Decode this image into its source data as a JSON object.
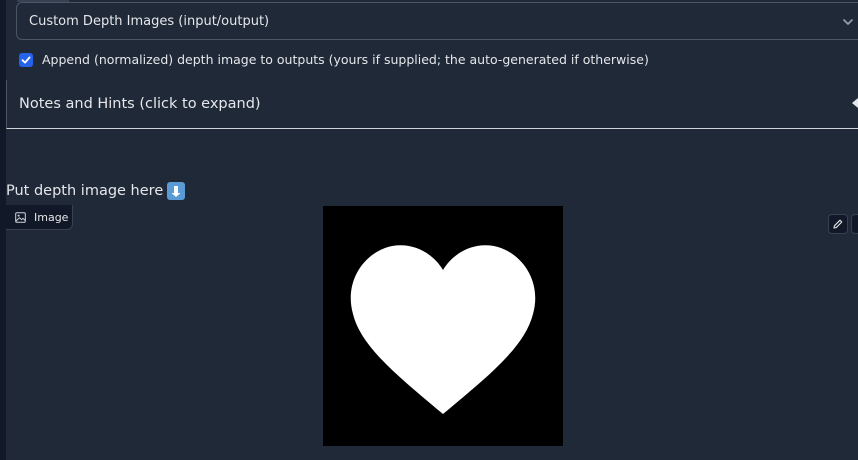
{
  "dropdown": {
    "value": "Custom Depth Images (input/output)"
  },
  "append_option": {
    "checked": true,
    "label": "Append (normalized) depth image to outputs (yours if supplied; the auto-generated if otherwise)"
  },
  "notes_accordion": {
    "label": "Notes and Hints (click to expand)"
  },
  "depth_upload": {
    "heading": "Put depth image here",
    "tab_label": "Image",
    "image_content": "heart-shape"
  },
  "colors": {
    "background": "#1f2937",
    "accent": "#2563eb",
    "text": "#e5e7eb"
  }
}
